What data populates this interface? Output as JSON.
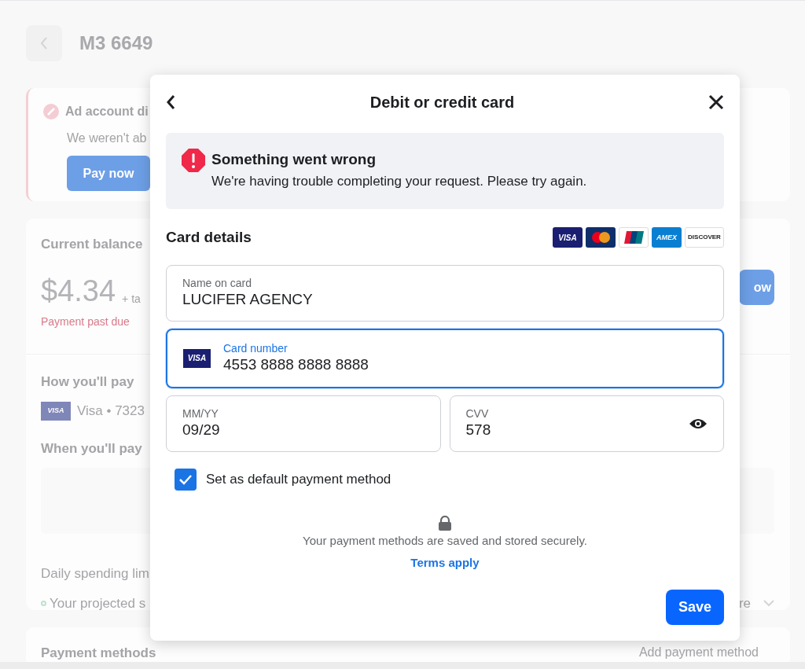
{
  "page": {
    "title": "M3 6649"
  },
  "alert": {
    "title": "Ad account di",
    "text": "We weren't ab",
    "button": "Pay now"
  },
  "balance": {
    "title": "Current balance",
    "amount": "$4.34",
    "tax": "+ ta",
    "status": "Payment past due",
    "button": "ow",
    "how_title": "How you'll pay",
    "card_logo": "VISA",
    "card": "Visa • 7323",
    "when_title": "When you'll pay",
    "limit_title": "Daily spending lim",
    "projected": "Your projected s",
    "more": "re"
  },
  "payment_methods": {
    "title": "Payment methods",
    "button": "Add payment method"
  },
  "dialog": {
    "title": "Debit or credit card",
    "error": {
      "title": "Something went wrong",
      "text": "We're having trouble completing your request. Please try again."
    },
    "section_title": "Card details",
    "card_brands": [
      {
        "kind": "visa",
        "label": "VISA"
      },
      {
        "kind": "mastercard"
      },
      {
        "kind": "unionpay"
      },
      {
        "kind": "amex",
        "label": "AMEX"
      },
      {
        "kind": "discover",
        "label": "DISCOVER"
      }
    ],
    "fields": [
      {
        "kind": "text",
        "label": "Name on card",
        "value": "LUCIFER AGENCY",
        "focused": false
      },
      {
        "kind": "card",
        "label": "Card number",
        "value": "4553 8888 8888 8888",
        "brand_label": "VISA",
        "focused": true
      },
      {
        "kind": "text",
        "label": "MM/YY",
        "value": "09/29",
        "focused": false
      },
      {
        "kind": "secret",
        "label": "CVV",
        "value": "578",
        "focused": false
      }
    ],
    "default_checkbox": {
      "label": "Set as default payment method",
      "checked": true
    },
    "secure_note": "Your payment methods are saved and stored securely.",
    "terms_link": "Terms apply",
    "save_button": "Save"
  }
}
